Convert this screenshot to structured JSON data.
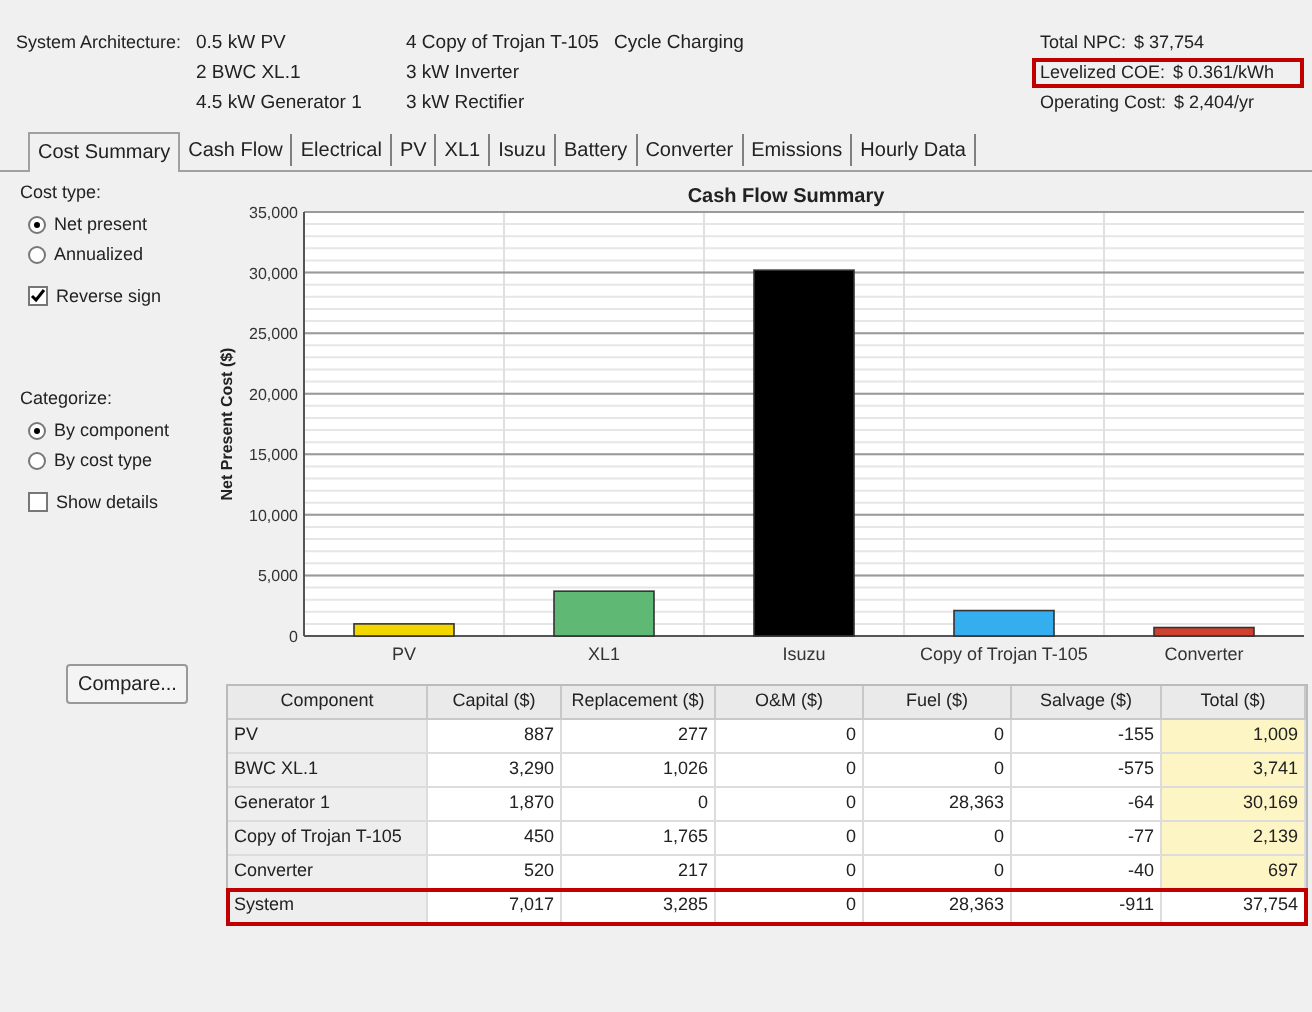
{
  "header": {
    "label": "System Architecture:",
    "columns": [
      [
        "0.5 kW PV",
        "2 BWC XL.1",
        "4.5 kW Generator 1"
      ],
      [
        "4 Copy of Trojan T-105",
        "3 kW Inverter",
        "3 kW Rectifier"
      ],
      [
        "Cycle Charging"
      ]
    ],
    "summary": [
      {
        "label": "Total NPC:",
        "value": "$ 37,754",
        "highlighted": false
      },
      {
        "label": "Levelized COE:",
        "value": "$ 0.361/kWh",
        "highlighted": true
      },
      {
        "label": "Operating Cost:",
        "value": "$ 2,404/yr",
        "highlighted": false
      }
    ]
  },
  "tabs": [
    {
      "label": "Cost Summary",
      "selected": true
    },
    {
      "label": "Cash Flow",
      "selected": false
    },
    {
      "label": "Electrical",
      "selected": false
    },
    {
      "label": "PV",
      "selected": false
    },
    {
      "label": "XL1",
      "selected": false
    },
    {
      "label": "Isuzu",
      "selected": false
    },
    {
      "label": "Battery",
      "selected": false
    },
    {
      "label": "Converter",
      "selected": false
    },
    {
      "label": "Emissions",
      "selected": false
    },
    {
      "label": "Hourly Data",
      "selected": false
    }
  ],
  "left_panel": {
    "groups": [
      {
        "label": "Cost type:",
        "options": [
          {
            "label": "Net present",
            "selected": true
          },
          {
            "label": "Annualized",
            "selected": false
          }
        ],
        "checkbox": {
          "label": "Reverse sign",
          "checked": true
        }
      },
      {
        "label": "Categorize:",
        "options": [
          {
            "label": "By component",
            "selected": true
          },
          {
            "label": "By cost type",
            "selected": false
          }
        ],
        "checkbox": {
          "label": "Show details",
          "checked": false
        }
      }
    ],
    "compare_button": "Compare..."
  },
  "chart_data": {
    "type": "bar",
    "title": "Cash Flow Summary",
    "ylabel": "Net Present Cost ($)",
    "stacked": true,
    "grid": true,
    "series": [
      {
        "name": "PV",
        "color": "#f2d600",
        "values": [
          1000,
          null,
          null,
          null,
          null
        ]
      },
      {
        "name": "XL1",
        "color": "#5fb873",
        "values": [
          null,
          3700,
          null,
          null,
          null
        ]
      },
      {
        "name": "Isuzu",
        "color": "#000000",
        "values": [
          null,
          null,
          30200,
          null,
          null
        ]
      },
      {
        "name": "Copy of Trojan T-105",
        "color": "#35aef0",
        "values": [
          null,
          null,
          null,
          2100,
          null
        ]
      },
      {
        "name": "Converter",
        "color": "#d0402e",
        "values": [
          null,
          null,
          null,
          null,
          700
        ]
      }
    ],
    "ylim": [
      0,
      35000
    ],
    "yticks": [
      {
        "value": 0,
        "label": "0"
      },
      {
        "value": 5000,
        "label": "5,000"
      },
      {
        "value": 10000,
        "label": "10,000"
      },
      {
        "value": 15000,
        "label": "15,000"
      },
      {
        "value": 20000,
        "label": "20,000"
      },
      {
        "value": 25000,
        "label": "25,000"
      },
      {
        "value": 30000,
        "label": "30,000"
      },
      {
        "value": 35000,
        "label": "35,000"
      }
    ]
  },
  "table": {
    "columns": [
      "Component",
      "Capital ($)",
      "Replacement ($)",
      "O&M ($)",
      "Fuel ($)",
      "Salvage ($)",
      "Total ($)"
    ],
    "rows": [
      {
        "cells": [
          "PV",
          "887",
          "277",
          "0",
          "0",
          "-155",
          "1,009"
        ],
        "highlighted": false
      },
      {
        "cells": [
          "BWC XL.1",
          "3,290",
          "1,026",
          "0",
          "0",
          "-575",
          "3,741"
        ],
        "highlighted": false
      },
      {
        "cells": [
          "Generator 1",
          "1,870",
          "0",
          "0",
          "28,363",
          "-64",
          "30,169"
        ],
        "highlighted": false
      },
      {
        "cells": [
          "Copy of Trojan T-105",
          "450",
          "1,765",
          "0",
          "0",
          "-77",
          "2,139"
        ],
        "highlighted": false
      },
      {
        "cells": [
          "Converter",
          "520",
          "217",
          "0",
          "0",
          "-40",
          "697"
        ],
        "highlighted": false
      },
      {
        "cells": [
          "System",
          "7,017",
          "3,285",
          "0",
          "28,363",
          "-911",
          "37,754"
        ],
        "highlighted": true
      }
    ]
  }
}
